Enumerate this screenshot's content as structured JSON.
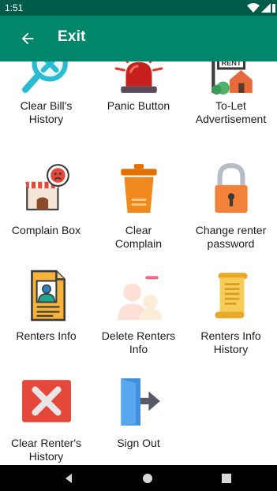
{
  "status_bar": {
    "time": "1:51"
  },
  "app_bar": {
    "title": "Exit",
    "back_icon": "arrow-left-icon"
  },
  "colors": {
    "status_bar": "#005c48",
    "app_bar": "#00876b",
    "nav_bar": "#000000"
  },
  "tiles": [
    {
      "label": "Clear Bill's\nHistory",
      "icon": "clear-search-icon"
    },
    {
      "label": "Panic Button",
      "icon": "siren-icon"
    },
    {
      "label": "To-Let\nAdvertisement",
      "icon": "rent-house-icon"
    },
    {
      "label": "Complain Box",
      "icon": "complaint-store-icon"
    },
    {
      "label": "Clear\nComplain",
      "icon": "trash-bin-icon"
    },
    {
      "label": "Change renter\npassword",
      "icon": "padlock-icon"
    },
    {
      "label": "Renters Info",
      "icon": "profile-document-icon"
    },
    {
      "label": "Delete Renters\nInfo",
      "icon": "delete-user-icon"
    },
    {
      "label": "Renters Info\nHistory",
      "icon": "scroll-icon"
    },
    {
      "label": "Clear Renter's\nHistory",
      "icon": "delete-x-icon"
    },
    {
      "label": "Sign Out",
      "icon": "sign-out-door-icon"
    }
  ],
  "nav_bar": {
    "back": "back-triangle-icon",
    "home": "home-circle-icon",
    "recents": "recents-square-icon"
  }
}
